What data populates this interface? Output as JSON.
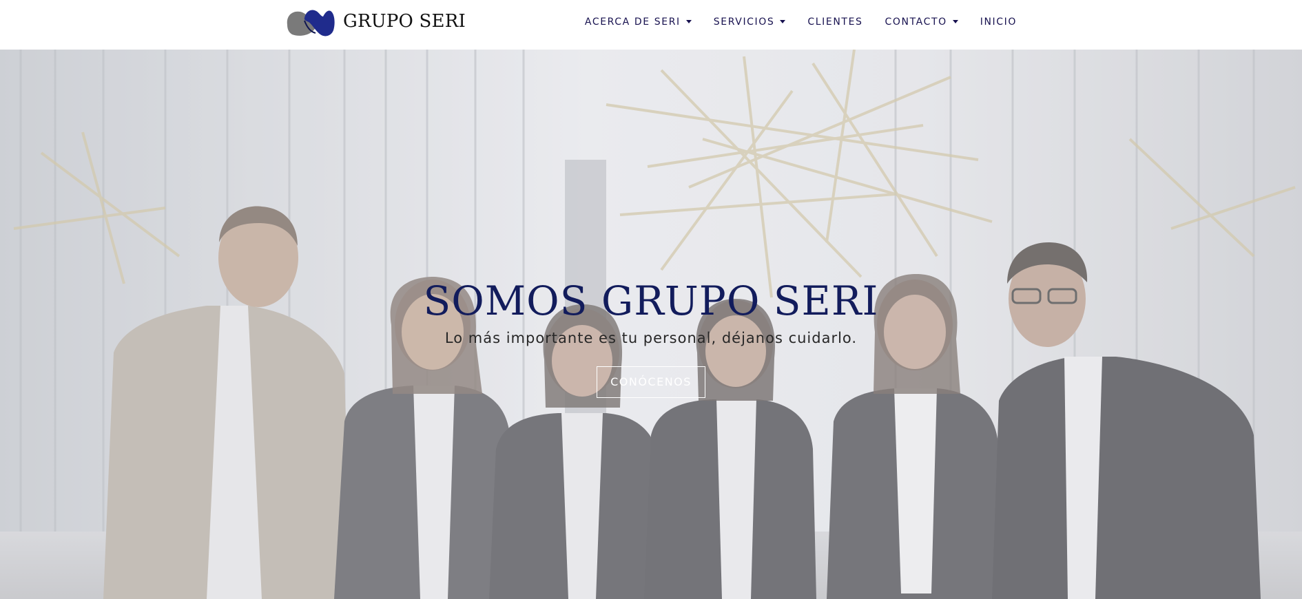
{
  "brand": {
    "name": "GRUPO SERI",
    "logo_icon": "grupo-seri-logo-mark",
    "logo_colors": [
      "#7a7a7a",
      "#1f2b8c"
    ]
  },
  "nav": {
    "items": [
      {
        "label": "ACERCA DE SERI",
        "dropdown": true
      },
      {
        "label": "SERVICIOS",
        "dropdown": true
      },
      {
        "label": "CLIENTES",
        "dropdown": false
      },
      {
        "label": "CONTACTO",
        "dropdown": true
      },
      {
        "label": "INICIO",
        "dropdown": false
      }
    ],
    "text_color": "#17114f"
  },
  "hero": {
    "title": "SOMOS GRUPO SERI",
    "subtitle": "Lo más importante es tu personal, déjanos cuidarlo.",
    "cta_label": "CONÓCENOS",
    "title_color": "#121c5c",
    "background_image": "team-photo-six-people-office-lobby"
  }
}
